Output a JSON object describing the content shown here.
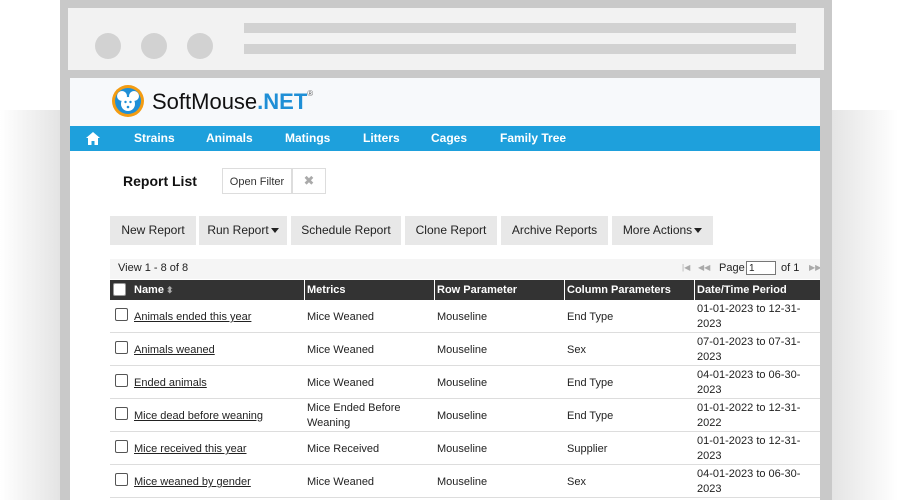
{
  "brand": {
    "name_part1": "SoftMouse",
    "name_part2": ".NET",
    "registered": "®"
  },
  "nav": {
    "items": [
      "Strains",
      "Animals",
      "Matings",
      "Litters",
      "Cages",
      "Family Tree"
    ]
  },
  "page": {
    "title": "Report List",
    "open_filter_label": "Open Filter",
    "clear_filter_glyph": "✖"
  },
  "toolbar": {
    "new_report": "New Report",
    "run_report": "Run Report",
    "schedule_report": "Schedule Report",
    "clone_report": "Clone Report",
    "archive_reports": "Archive Reports",
    "more_actions": "More Actions"
  },
  "pager": {
    "view_text": "View 1 - 8 of 8",
    "page_label": "Page",
    "page_value": "1",
    "of_text": "of 1",
    "first_glyph": "|◀",
    "prev_glyph": "◀◀",
    "next_glyph": "▶▶"
  },
  "table": {
    "headers": {
      "name": "Name",
      "metrics": "Metrics",
      "row_parameter": "Row Parameter",
      "column_parameters": "Column Parameters",
      "date_period": "Date/Time Period"
    },
    "sort_glyph": "⬍",
    "rows": [
      {
        "name": "Animals ended this year",
        "metrics": "Mice Weaned",
        "row_param": "Mouseline",
        "col_params": "End Type",
        "date": "01-01-2023 to 12-31-2023"
      },
      {
        "name": "Animals weaned",
        "metrics": "Mice Weaned",
        "row_param": "Mouseline",
        "col_params": "Sex",
        "date": "07-01-2023 to 07-31-2023"
      },
      {
        "name": "Ended animals",
        "metrics": "Mice Weaned",
        "row_param": "Mouseline",
        "col_params": "End Type",
        "date": "04-01-2023 to 06-30-2023"
      },
      {
        "name": "Mice dead before weaning",
        "metrics": "Mice Ended Before Weaning",
        "row_param": "Mouseline",
        "col_params": "End Type",
        "date": "01-01-2022 to 12-31-2022"
      },
      {
        "name": "Mice received this year",
        "metrics": "Mice Received",
        "row_param": "Mouseline",
        "col_params": "Supplier",
        "date": "01-01-2023 to 12-31-2023"
      },
      {
        "name": "Mice weaned by gender",
        "metrics": "Mice Weaned",
        "row_param": "Mouseline",
        "col_params": "Sex",
        "date": "04-01-2023 to 06-30-2023"
      }
    ]
  },
  "colors": {
    "nav_bg": "#1ea0dc",
    "table_header_bg": "#333333",
    "brand_accent": "#1f8fd6",
    "button_bg": "#e8e8e8"
  }
}
